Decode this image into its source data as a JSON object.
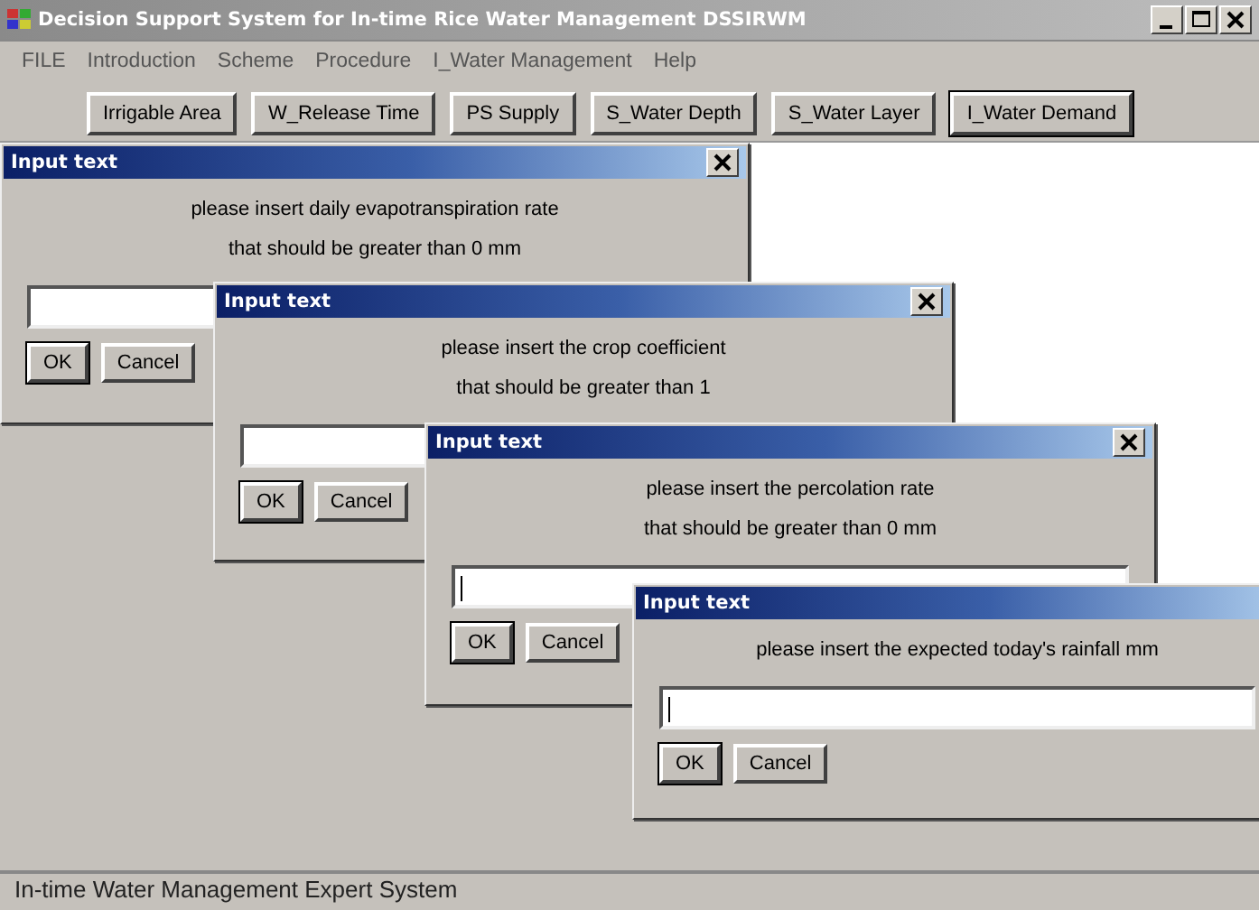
{
  "window": {
    "title": "Decision Support System for In-time Rice Water Management DSSIRWM"
  },
  "menu": [
    "FILE",
    "Introduction",
    "Scheme",
    "Procedure",
    "I_Water Management",
    "Help"
  ],
  "toolbar": [
    {
      "label": "Irrigable Area",
      "selected": false
    },
    {
      "label": "W_Release Time",
      "selected": false
    },
    {
      "label": "PS Supply",
      "selected": false
    },
    {
      "label": "S_Water Depth",
      "selected": false
    },
    {
      "label": "S_Water Layer",
      "selected": false
    },
    {
      "label": "I_Water Demand",
      "selected": true
    }
  ],
  "dialogs": [
    {
      "title": "Input text",
      "lines": [
        "please insert daily evapotranspiration rate",
        "that should be greater than 0 mm"
      ],
      "caret": false,
      "close_visible": true,
      "buttons": [
        "OK",
        "Cancel"
      ]
    },
    {
      "title": "Input text",
      "lines": [
        "please insert the crop coefficient",
        "that should be greater than 1"
      ],
      "caret": false,
      "close_visible": true,
      "buttons": [
        "OK",
        "Cancel"
      ]
    },
    {
      "title": "Input text",
      "lines": [
        "please insert the percolation rate",
        "that should be greater than 0 mm"
      ],
      "caret": true,
      "close_visible": true,
      "buttons": [
        "OK",
        "Cancel"
      ]
    },
    {
      "title": "Input text",
      "lines": [
        "please insert the expected today's rainfall mm"
      ],
      "caret": true,
      "close_visible": false,
      "buttons": [
        "OK",
        "Cancel"
      ]
    }
  ],
  "status_bar": "In-time Water Management Expert System"
}
